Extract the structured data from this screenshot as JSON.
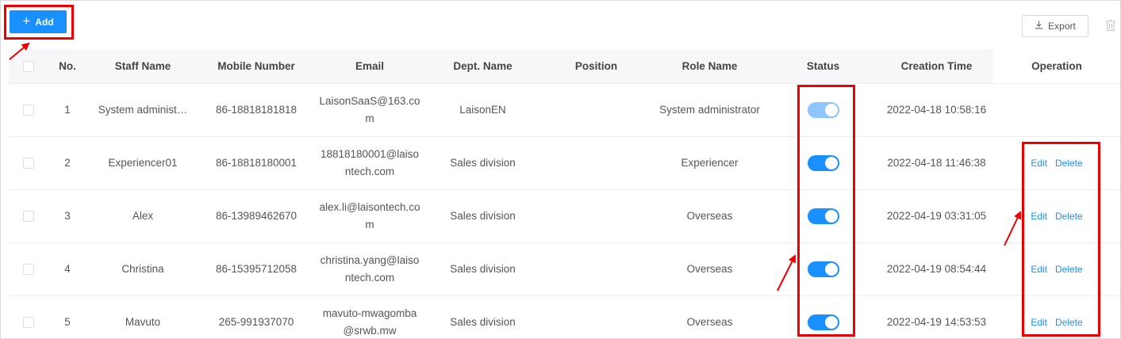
{
  "toolbar": {
    "add_label": "Add",
    "add_icon": "plus-icon",
    "export_label": "Export",
    "export_icon": "download-icon",
    "delete_icon": "trash-icon",
    "accent_color": "#1890ff"
  },
  "table": {
    "columns": [
      "No.",
      "Staff Name",
      "Mobile Number",
      "Email",
      "Dept. Name",
      "Position",
      "Role Name",
      "Status",
      "Creation Time",
      "Operation"
    ],
    "rows": [
      {
        "no": "1",
        "staff_name": "System administ…",
        "mobile": "86-18818181818",
        "email": "LaisonSaaS@163.com",
        "dept": "LaisonEN",
        "position": "",
        "role": "System administrator",
        "status_on": true,
        "status_disabled": true,
        "created": "2022-04-18 10:58:16",
        "edit_label": "",
        "delete_label": ""
      },
      {
        "no": "2",
        "staff_name": "Experiencer01",
        "mobile": "86-18818180001",
        "email": "18818180001@laisontech.com",
        "dept": "Sales division",
        "position": "",
        "role": "Experiencer",
        "status_on": true,
        "status_disabled": false,
        "created": "2022-04-18 11:46:38",
        "edit_label": "Edit",
        "delete_label": "Delete"
      },
      {
        "no": "3",
        "staff_name": "Alex",
        "mobile": "86-13989462670",
        "email": "alex.li@laisontech.com",
        "dept": "Sales division",
        "position": "",
        "role": "Overseas",
        "status_on": true,
        "status_disabled": false,
        "created": "2022-04-19 03:31:05",
        "edit_label": "Edit",
        "delete_label": "Delete"
      },
      {
        "no": "4",
        "staff_name": "Christina",
        "mobile": "86-15395712058",
        "email": "christina.yang@laisontech.com",
        "dept": "Sales division",
        "position": "",
        "role": "Overseas",
        "status_on": true,
        "status_disabled": false,
        "created": "2022-04-19 08:54:44",
        "edit_label": "Edit",
        "delete_label": "Delete"
      },
      {
        "no": "5",
        "staff_name": "Mavuto",
        "mobile": "265-991937070",
        "email": "mavuto-mwagomba@srwb.mw",
        "dept": "Sales division",
        "position": "",
        "role": "Overseas",
        "status_on": true,
        "status_disabled": false,
        "created": "2022-04-19 14:53:53",
        "edit_label": "Edit",
        "delete_label": "Delete"
      }
    ]
  },
  "annotations": {
    "highlight_color": "#ee0000",
    "highlights": [
      "add-button",
      "status-column",
      "operation-column"
    ]
  }
}
